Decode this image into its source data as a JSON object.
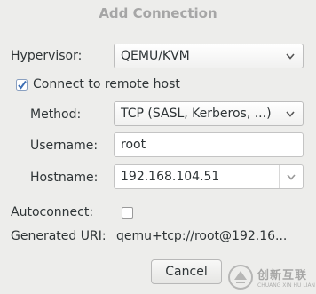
{
  "dialog": {
    "title": "Add Connection",
    "hypervisor_label": "Hypervisor:",
    "hypervisor_value": "QEMU/KVM",
    "remote_checkbox_label": "Connect to remote host",
    "remote_checked": true,
    "method_label": "Method:",
    "method_value": "TCP (SASL, Kerberos, ...)",
    "username_label": "Username:",
    "username_value": "root",
    "hostname_label": "Hostname:",
    "hostname_value": "192.168.104.51",
    "autoconnect_label": "Autoconnect:",
    "autoconnect_checked": false,
    "uri_label": "Generated URI:",
    "uri_value": "qemu+tcp://root@192.16...",
    "cancel_label": "Cancel"
  },
  "watermark": {
    "text": "创新互联",
    "subtext": "CHUANG XIN HU LIAN",
    "icon": "logo-icon"
  },
  "colors": {
    "background": "#ededeb",
    "title": "#a6a6a6",
    "check_accent": "#3d6fb5"
  }
}
